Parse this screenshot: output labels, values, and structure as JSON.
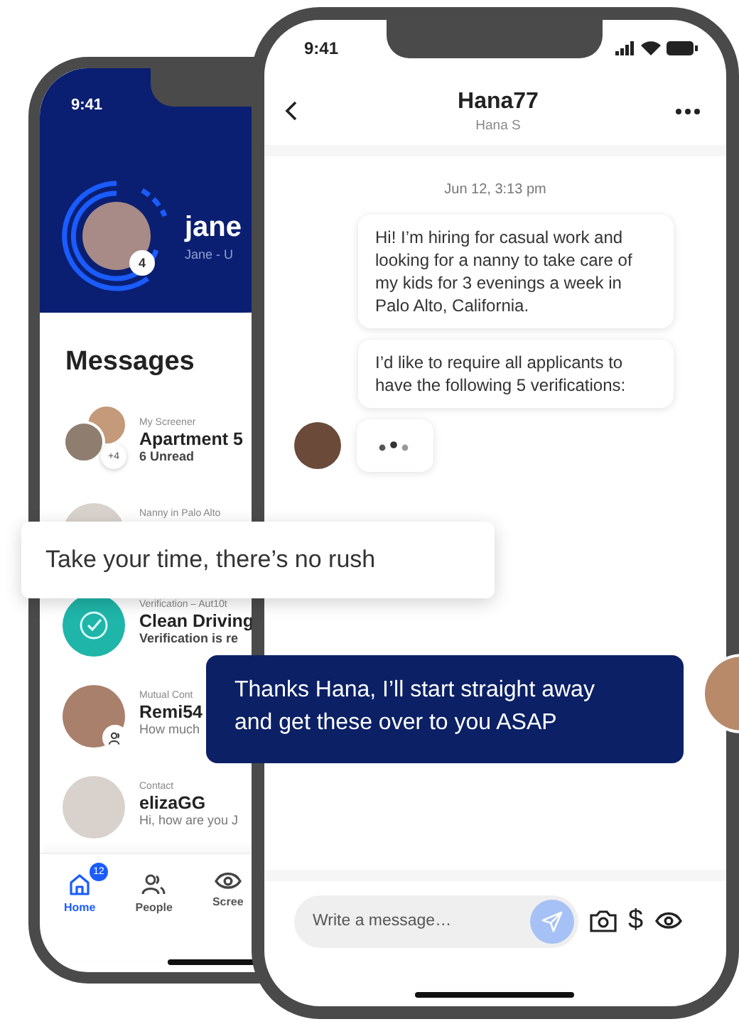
{
  "left_phone": {
    "status_time": "9:41",
    "profile": {
      "username": "jane",
      "subtitle": "Jane - U",
      "badge": "4"
    },
    "title": "Messages",
    "conversations": [
      {
        "kind": "group",
        "label": "My Screener",
        "name": "Apartment 5",
        "preview": "6 Unread",
        "extra": "+4"
      },
      {
        "kind": "single",
        "label": "Nanny in Palo Alto"
      },
      {
        "kind": "verification",
        "label": "Verification – Aut10t",
        "name": "Clean Driving",
        "preview": "Verification is re"
      },
      {
        "kind": "mutual",
        "label": "Mutual Cont",
        "name": "Remi54",
        "preview": "How much"
      },
      {
        "kind": "single",
        "label": "Contact",
        "name": "elizaGG",
        "preview": "Hi, how are you J"
      }
    ],
    "tabs": [
      {
        "label": "Home",
        "selected": true,
        "badge": "12"
      },
      {
        "label": "People",
        "selected": false
      },
      {
        "label": "Scree",
        "selected": false
      }
    ]
  },
  "right_phone": {
    "status_time": "9:41",
    "contact": {
      "username": "Hana77",
      "name": "Hana S"
    },
    "date": "Jun 12, 3:13 pm",
    "messages": [
      {
        "text": "Hi! I’m hiring for casual work and looking for a nanny to take care of my kids for 3 evenings a week in Palo Alto, California."
      },
      {
        "text": "I’d like to require all applicants to have the following 5 verifications:"
      }
    ],
    "typing": true,
    "composer": {
      "placeholder": "Write a message…",
      "currency_symbol": "$"
    }
  },
  "floating_messages": [
    {
      "kind": "received",
      "text": "Take your time, there’s no rush"
    },
    {
      "kind": "sent",
      "text": "Thanks Hana, I’ll start straight away and get these over to you ASAP"
    }
  ]
}
